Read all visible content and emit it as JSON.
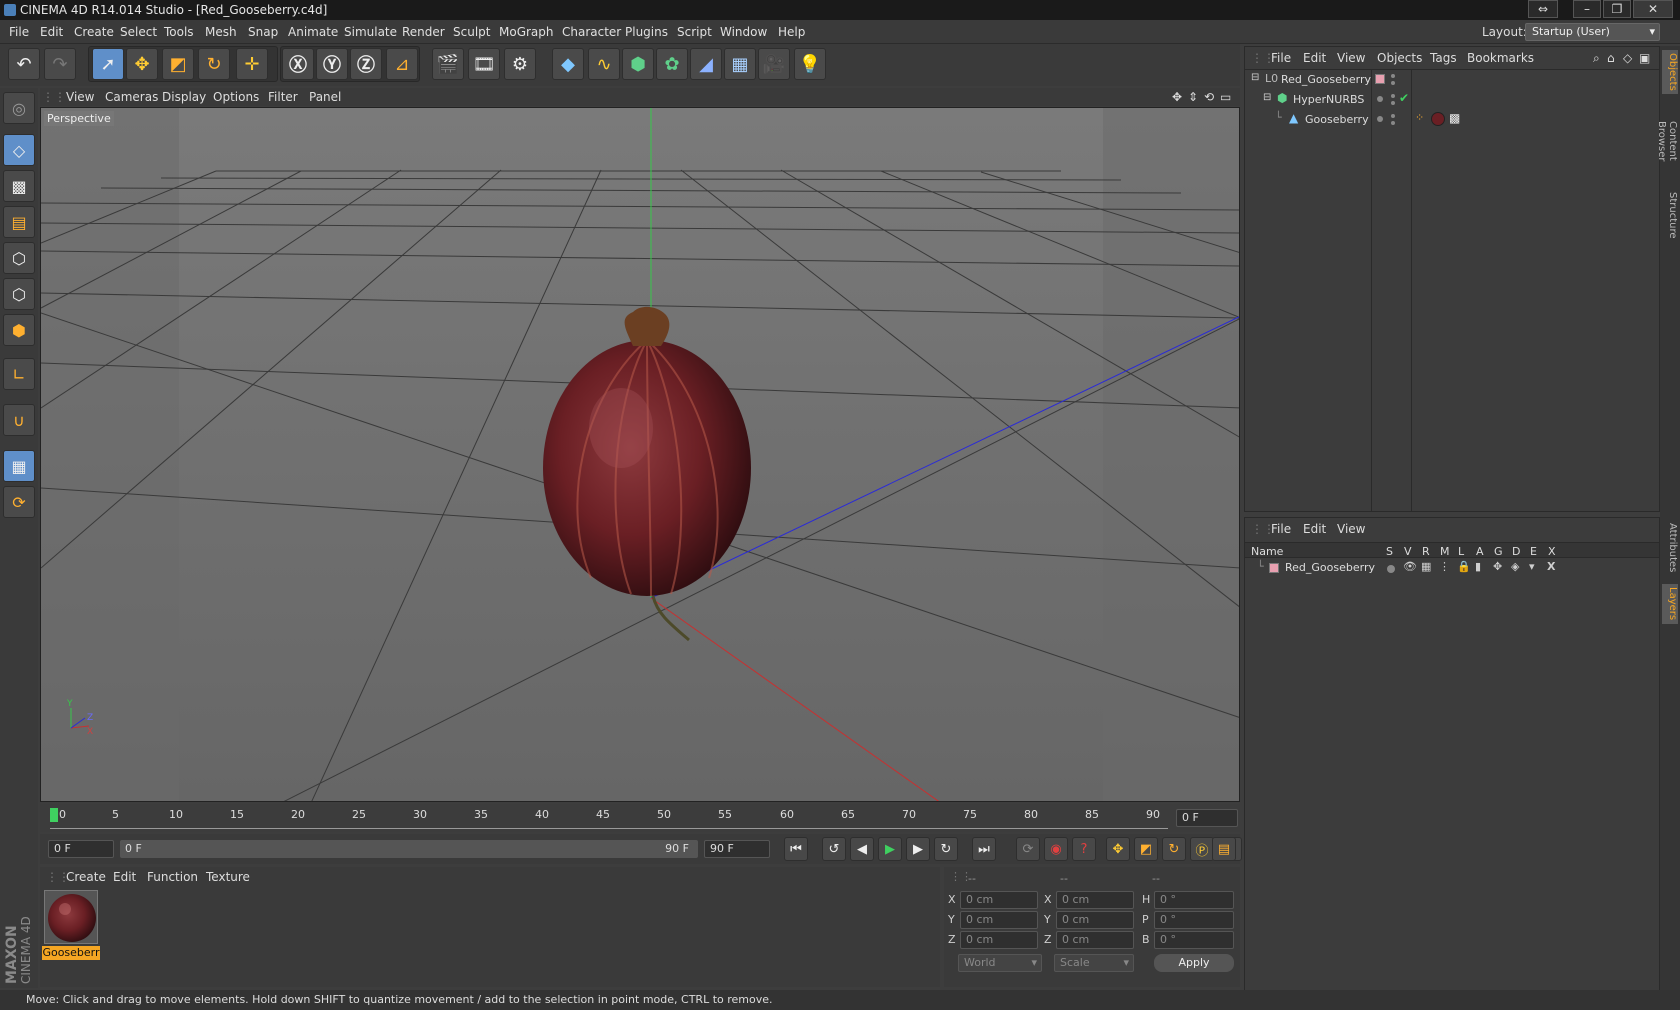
{
  "window": {
    "title": "CINEMA 4D R14.014 Studio - [Red_Gooseberry.c4d]",
    "layout_label": "Layout:",
    "layout_value": "Startup (User)"
  },
  "menubar": [
    "File",
    "Edit",
    "Create",
    "Select",
    "Tools",
    "Mesh",
    "Snap",
    "Animate",
    "Simulate",
    "Render",
    "Sculpt",
    "MoGraph",
    "Character",
    "Plugins",
    "Script",
    "Window",
    "Help"
  ],
  "viewport": {
    "menu": [
      "View",
      "Cameras",
      "Display",
      "Options",
      "Filter",
      "Panel"
    ],
    "label": "Perspective",
    "axis_y": "Y",
    "axis_z": "Z",
    "axis_x": "X"
  },
  "timeline": {
    "ticks": [
      "0",
      "5",
      "10",
      "15",
      "20",
      "25",
      "30",
      "35",
      "40",
      "45",
      "50",
      "55",
      "60",
      "65",
      "70",
      "75",
      "80",
      "85",
      "90"
    ],
    "current_frame": "0 F",
    "start_field": "0 F",
    "range_start": "0 F",
    "range_end": "90 F",
    "end_field": "90 F"
  },
  "objects_panel": {
    "menu": [
      "File",
      "Edit",
      "View",
      "Objects",
      "Tags",
      "Bookmarks"
    ],
    "rows": [
      {
        "name": "Red_Gooseberry"
      },
      {
        "name": "HyperNURBS"
      },
      {
        "name": "Gooseberry"
      }
    ]
  },
  "layers_panel": {
    "menu": [
      "File",
      "Edit",
      "View"
    ],
    "header_name": "Name",
    "columns": [
      "S",
      "V",
      "R",
      "M",
      "L",
      "A",
      "G",
      "D",
      "E",
      "X"
    ],
    "rows": [
      {
        "name": "Red_Gooseberry"
      }
    ]
  },
  "side_tabs": [
    "Objects",
    "Content Browser",
    "Structure",
    "Attributes",
    "Layers"
  ],
  "material_panel": {
    "menu": [
      "Create",
      "Edit",
      "Function",
      "Texture"
    ],
    "material_name": "Gooseberr"
  },
  "coord_panel": {
    "headers": [
      "--",
      "--",
      "--"
    ],
    "rows": [
      {
        "a": "X",
        "av": "0 cm",
        "b": "X",
        "bv": "0 cm",
        "c": "H",
        "cv": "0 °"
      },
      {
        "a": "Y",
        "av": "0 cm",
        "b": "Y",
        "bv": "0 cm",
        "c": "P",
        "cv": "0 °"
      },
      {
        "a": "Z",
        "av": "0 cm",
        "b": "Z",
        "bv": "0 cm",
        "c": "B",
        "cv": "0 °"
      }
    ],
    "mode1": "World",
    "mode2": "Scale",
    "apply": "Apply"
  },
  "status": "Move: Click and drag to move elements. Hold down SHIFT to quantize movement / add to the selection in point mode, CTRL to remove.",
  "brand": {
    "line1": "MAXON",
    "line2": "CINEMA 4D"
  }
}
